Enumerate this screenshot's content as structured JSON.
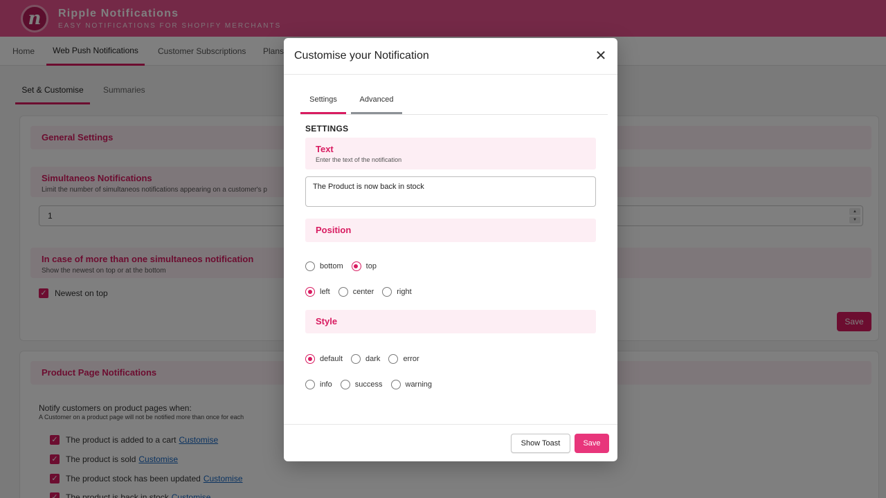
{
  "app": {
    "logo_letter": "n",
    "title": "Ripple Notifications",
    "subtitle": "EASY NOTIFICATIONS FOR SHOPIFY MERCHANTS"
  },
  "nav": {
    "items": [
      "Home",
      "Web Push Notifications",
      "Customer Subscriptions",
      "Plans"
    ],
    "active": "Web Push Notifications"
  },
  "sub_tabs": {
    "items": [
      "Set & Customise",
      "Summaries"
    ],
    "active": "Set & Customise"
  },
  "general_settings": {
    "title": "General Settings",
    "simultaneous": {
      "title": "Simultaneos Notifications",
      "description": "Limit the number of simultaneos notifications appearing on a customer's p",
      "value": "1"
    },
    "more_than_one": {
      "title": "In case of more than one simultaneos notification",
      "description": "Show the newest on top or at the bottom",
      "checkbox_label": "Newest on top"
    },
    "save_label": "Save"
  },
  "product_page": {
    "title": "Product Page Notifications",
    "intro": "Notify customers on product pages when:",
    "note": "A Customer on a product page will not be notified more than once for each",
    "items": [
      {
        "label": "The product is added to a cart",
        "link": "Customise"
      },
      {
        "label": "The product is sold",
        "link": "Customise"
      },
      {
        "label": "The product stock has been updated",
        "link": "Customise"
      },
      {
        "label": "The product is back in stock",
        "link": "Customise"
      }
    ]
  },
  "modal": {
    "title": "Customise your Notification",
    "close_glyph": "✕",
    "tabs": [
      "Settings",
      "Advanced"
    ],
    "active_tab": "Settings",
    "heading": "SETTINGS",
    "text_section": {
      "title": "Text",
      "description": "Enter the text of the notification",
      "value": "The Product is now back in stock"
    },
    "position_section": {
      "title": "Position",
      "vertical": [
        "bottom",
        "top"
      ],
      "vertical_selected": "top",
      "horizontal": [
        "left",
        "center",
        "right"
      ],
      "horizontal_selected": "left"
    },
    "style_section": {
      "title": "Style",
      "row1": [
        "default",
        "dark",
        "error"
      ],
      "row2": [
        "info",
        "success",
        "warning"
      ],
      "selected": "default"
    },
    "show_toast_label": "Show Toast",
    "save_label": "Save"
  },
  "colors": {
    "brand": "#e8538f",
    "accent": "#d81b60",
    "section_bg": "#fdeef4"
  }
}
